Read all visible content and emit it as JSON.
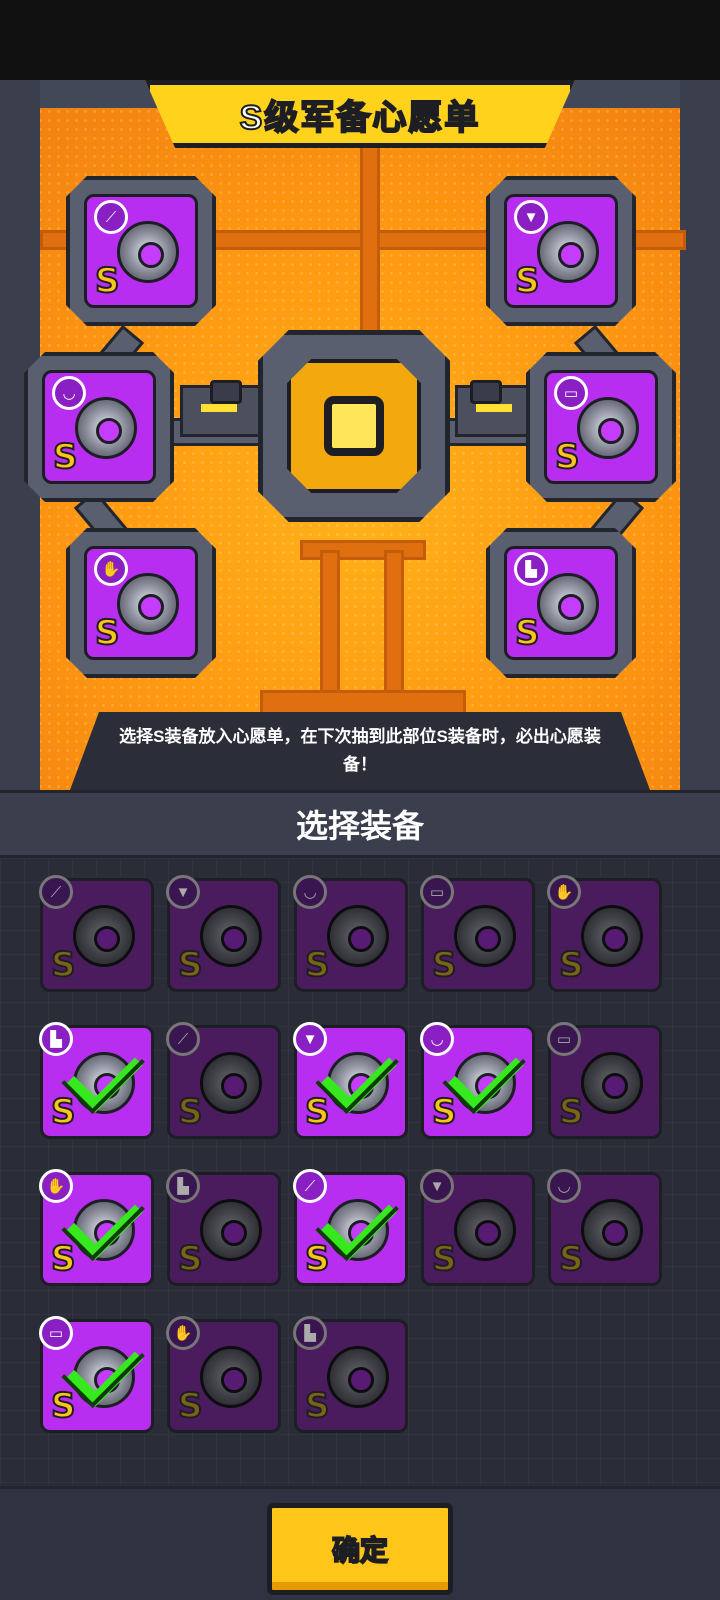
{
  "wishlist": {
    "title": "S级军备心愿单",
    "hint": "选择S装备放入心愿单，在下次抽到此部位S装备时，必出心愿装备！",
    "slots": [
      {
        "slot": "weapon",
        "badge_icon": "dagger-icon",
        "badge_glyph": "⟋",
        "grade": "S"
      },
      {
        "slot": "armor",
        "badge_icon": "shirt-icon",
        "badge_glyph": "▼",
        "grade": "S"
      },
      {
        "slot": "necklace",
        "badge_icon": "necklace-icon",
        "badge_glyph": "◡",
        "grade": "S"
      },
      {
        "slot": "belt",
        "badge_icon": "belt-icon",
        "badge_glyph": "▭",
        "grade": "S"
      },
      {
        "slot": "glove",
        "badge_icon": "glove-icon",
        "badge_glyph": "✋",
        "grade": "S"
      },
      {
        "slot": "boots",
        "badge_icon": "boot-icon",
        "badge_glyph": "▙",
        "grade": "S"
      }
    ]
  },
  "select": {
    "header": "选择装备",
    "items": [
      {
        "badge_icon": "dagger-icon",
        "badge_glyph": "⟋",
        "grade": "S",
        "owned": false,
        "selected": false
      },
      {
        "badge_icon": "shirt-icon",
        "badge_glyph": "▼",
        "grade": "S",
        "owned": false,
        "selected": false
      },
      {
        "badge_icon": "necklace-icon",
        "badge_glyph": "◡",
        "grade": "S",
        "owned": false,
        "selected": false
      },
      {
        "badge_icon": "belt-icon",
        "badge_glyph": "▭",
        "grade": "S",
        "owned": false,
        "selected": false
      },
      {
        "badge_icon": "glove-icon",
        "badge_glyph": "✋",
        "grade": "S",
        "owned": false,
        "selected": false
      },
      {
        "badge_icon": "boot-icon",
        "badge_glyph": "▙",
        "grade": "S",
        "owned": true,
        "selected": true
      },
      {
        "badge_icon": "dagger-icon",
        "badge_glyph": "⟋",
        "grade": "S",
        "owned": false,
        "selected": false
      },
      {
        "badge_icon": "shirt-icon",
        "badge_glyph": "▼",
        "grade": "S",
        "owned": true,
        "selected": true
      },
      {
        "badge_icon": "necklace-icon",
        "badge_glyph": "◡",
        "grade": "S",
        "owned": true,
        "selected": true
      },
      {
        "badge_icon": "belt-icon",
        "badge_glyph": "▭",
        "grade": "S",
        "owned": false,
        "selected": false
      },
      {
        "badge_icon": "glove-icon",
        "badge_glyph": "✋",
        "grade": "S",
        "owned": true,
        "selected": true
      },
      {
        "badge_icon": "boot-icon",
        "badge_glyph": "▙",
        "grade": "S",
        "owned": false,
        "selected": false
      },
      {
        "badge_icon": "dagger-icon",
        "badge_glyph": "⟋",
        "grade": "S",
        "owned": true,
        "selected": true
      },
      {
        "badge_icon": "shirt-icon",
        "badge_glyph": "▼",
        "grade": "S",
        "owned": false,
        "selected": false
      },
      {
        "badge_icon": "necklace-icon",
        "badge_glyph": "◡",
        "grade": "S",
        "owned": false,
        "selected": false
      },
      {
        "badge_icon": "belt-icon",
        "badge_glyph": "▭",
        "grade": "S",
        "owned": true,
        "selected": true
      },
      {
        "badge_icon": "glove-icon",
        "badge_glyph": "✋",
        "grade": "S",
        "owned": false,
        "selected": false
      },
      {
        "badge_icon": "boot-icon",
        "badge_glyph": "▙",
        "grade": "S",
        "owned": false,
        "selected": false
      }
    ]
  },
  "footer": {
    "confirm_label": "确定"
  },
  "colors": {
    "accent": "#ffc61a",
    "rarity_purple": "#b72ef0",
    "check_green": "#36e81e",
    "panel_orange": "#ff9a12"
  }
}
